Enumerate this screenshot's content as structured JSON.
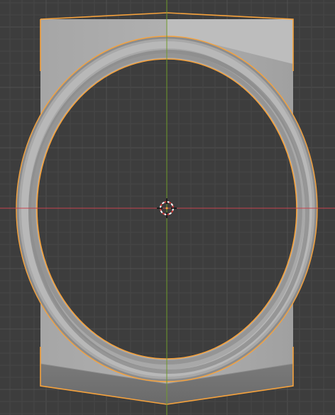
{
  "viewport": {
    "background": "#3d3d3d",
    "grid_minor_color": "#464646",
    "grid_major_color": "#505050",
    "x_axis_color": "#c8444f",
    "y_axis_color": "#6f9a2c",
    "selection_outline_color": "#f6a23c",
    "object_face_color": "#a9a9a9",
    "object_shadow_color": "#858585",
    "cursor_ring_colors": [
      "#ffffff",
      "#d23a3a"
    ],
    "cursor_icon": "3d-cursor-icon",
    "selected_object": "ring-frame-mesh"
  }
}
